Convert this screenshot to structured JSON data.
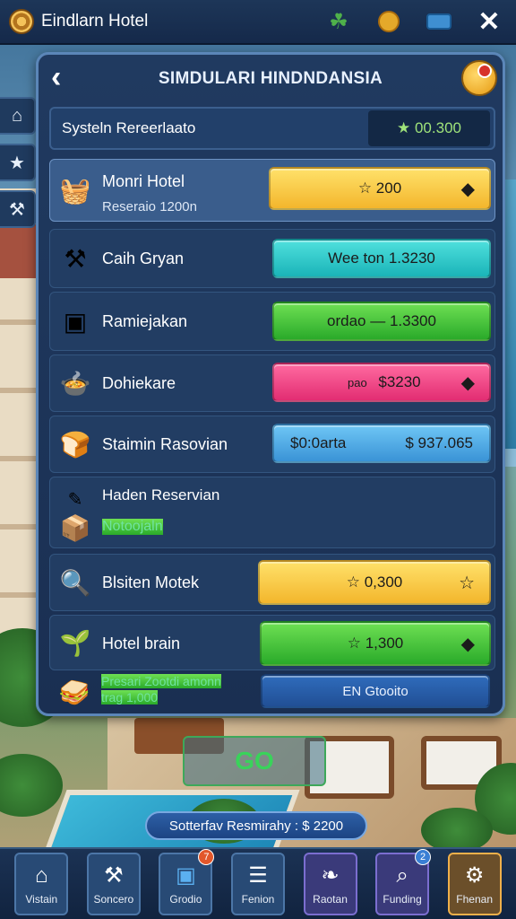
{
  "app": {
    "title": "Eindlarn Hotel"
  },
  "panel": {
    "title": "SIMDULARI HINDNDANSIA",
    "system": {
      "label": "Systeln Rereerlaato",
      "value": "★ 00.300"
    }
  },
  "rows": [
    {
      "icon": "food-basket-icon",
      "label": "Monri Hotel",
      "sub": "Reseraio 1200n",
      "value": "☆ 200",
      "style": "gold"
    },
    {
      "icon": "tools-icon",
      "label": "Caih Gryan",
      "value": "Wee ton 1.3230",
      "style": "teal"
    },
    {
      "icon": "box-icon",
      "label": "Ramiejakan",
      "value": "ordao — 1.3300",
      "style": "green"
    },
    {
      "icon": "dish-icon",
      "label": "Dohiekare",
      "value": "$3230",
      "value_prefix": "pao",
      "style": "pink"
    },
    {
      "icon": "bread-basket-icon",
      "label": "Staimin Rasovian",
      "value_left": "$0:0arta",
      "value": "$ 937.065",
      "style": "blue"
    },
    {
      "icon": "food-crate-icon",
      "label": "Haden Reservian",
      "sub": "Notoojaln"
    },
    {
      "icon": "magnifier-icon",
      "label": "Blsiten Motek",
      "value": "☆ 0,300",
      "style": "gold"
    },
    {
      "icon": "plant-box-icon",
      "label": "Hotel brain",
      "value": "☆ 1,300",
      "style": "green"
    },
    {
      "icon": "sandwich-icon",
      "label": "Presari Zootdi amonn",
      "sub": "trag 1,000",
      "value": "EN Gtooito",
      "style": "navy"
    }
  ],
  "go_button": "GO",
  "promo": "Sotterfav Resmirahy : $ 2200",
  "nav": [
    {
      "icon": "home-icon",
      "label": "Vistain"
    },
    {
      "icon": "hammer-icon",
      "label": "Soncero"
    },
    {
      "icon": "box-icon",
      "label": "Grodio",
      "badge": "7"
    },
    {
      "icon": "notes-icon",
      "label": "Fenion"
    },
    {
      "icon": "leaf-icon",
      "label": "Raotan"
    },
    {
      "icon": "search-icon",
      "label": "Funding",
      "badge": "2"
    },
    {
      "icon": "gear-icon",
      "label": "Fhenan"
    }
  ],
  "colors": {
    "panel": "#1f3a60",
    "accent": "#5b86b8",
    "gold": "#f3b62c",
    "green": "#2aaa2a"
  }
}
